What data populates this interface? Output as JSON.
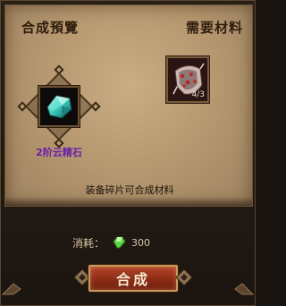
{
  "header": {
    "preview_title": "合成預覽",
    "materials_title": "需要材料"
  },
  "result_item": {
    "name": "2阶云精石",
    "icon": "cyan-crystal-gem-icon"
  },
  "material_item": {
    "count": "4/3",
    "icon": "ornate-fragment-icon"
  },
  "hint_text": "装备碎片可合成材料",
  "cost": {
    "label": "消耗：",
    "icon": "green-gem-currency-icon",
    "value": "300"
  },
  "action": {
    "button_label": "合成"
  },
  "colors": {
    "title_text": "#2e1d0d",
    "gem_name": "#6a1fa8",
    "button_fill": "#8c2c15",
    "button_border": "#c89a5a"
  }
}
